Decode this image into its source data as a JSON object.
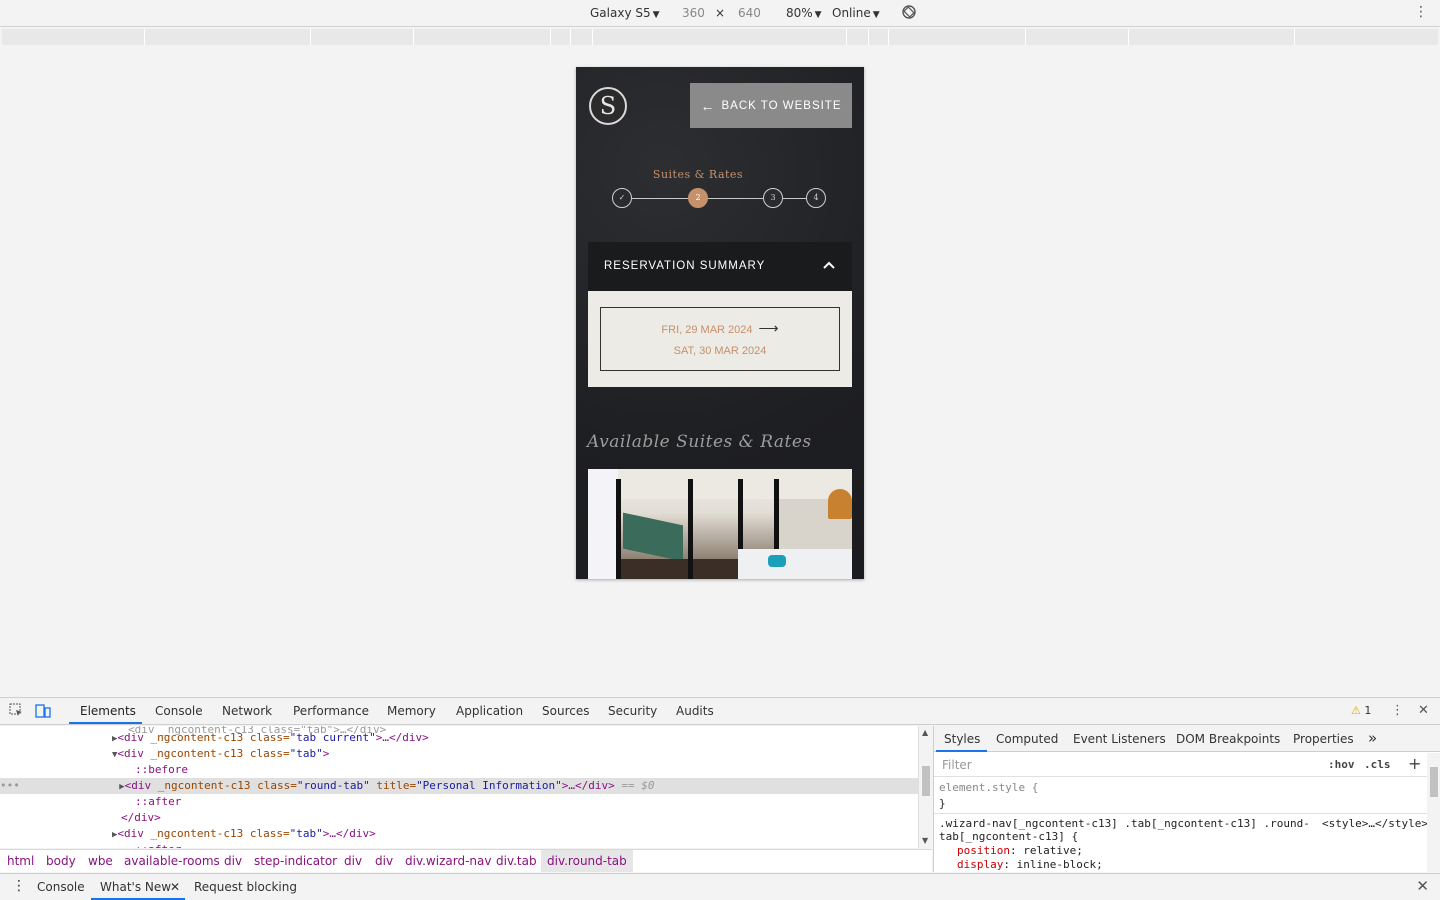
{
  "device_toolbar": {
    "device": "Galaxy S5",
    "width": "360",
    "times": "×",
    "height": "640",
    "zoom": "80%",
    "network": "Online"
  },
  "site": {
    "logo_letter": "S",
    "back_button": "BACK TO WEBSITE",
    "step_label": "Suites & Rates",
    "steps": [
      "✓",
      "2",
      "3",
      "4"
    ],
    "active_step": 2,
    "summary_title": "RESERVATION SUMMARY",
    "check_in": "FRI, 29 MAR 2024",
    "check_out": "SAT, 30 MAR 2024",
    "available_title": "Available Suites & Rates",
    "accent_color": "#c6906a"
  },
  "devtools": {
    "tabs": [
      "Elements",
      "Console",
      "Network",
      "Performance",
      "Memory",
      "Application",
      "Sources",
      "Security",
      "Audits"
    ],
    "selected_tab": "Elements",
    "warnings_count": "1",
    "dom_lines": [
      {
        "open": "<div",
        "attr": " _ngcontent-c13 class=",
        "val": "\"tab current\"",
        "close": ">…</div>"
      },
      {
        "open": "<div",
        "attr": " _ngcontent-c13 class=",
        "val": "\"tab\"",
        "close": ">"
      },
      {
        "pseudo": "::before"
      },
      {
        "open": "<div",
        "attr": " _ngcontent-c13 class=",
        "val": "\"round-tab\"",
        "attr2": " title=",
        "val2": "\"Personal Information\"",
        "close": ">…</div>",
        "tail": " == $0"
      },
      {
        "pseudo": "::after"
      },
      {
        "close_tag": "</div>"
      },
      {
        "open": "<div",
        "attr": " _ngcontent-c13 class=",
        "val": "\"tab\"",
        "close": ">…</div>"
      }
    ],
    "breadcrumbs": [
      "html",
      "body",
      "wbe",
      "available-rooms",
      "div",
      "step-indicator",
      "div",
      "div",
      "div.wizard-nav",
      "div.tab",
      "div.round-tab"
    ],
    "styles_tabs": [
      "Styles",
      "Computed",
      "Event Listeners",
      "DOM Breakpoints",
      "Properties"
    ],
    "filter_placeholder": "Filter",
    "hov": ":hov",
    "cls": ".cls",
    "element_style_open": "element.style {",
    "element_style_close": "}",
    "rule_selector_1": ".wizard-nav[_ngcontent-c13] .tab[_ngcontent-c13] .round-",
    "rule_selector_2": "tab[_ngcontent-c13] {",
    "rule_source": "<style>…</style>",
    "rule_props": [
      {
        "name": "position",
        "value": "relative;"
      },
      {
        "name": "display",
        "value": "inline-block;"
      }
    ],
    "drawer_tabs": [
      "Console",
      "What's New",
      "Request blocking"
    ]
  }
}
